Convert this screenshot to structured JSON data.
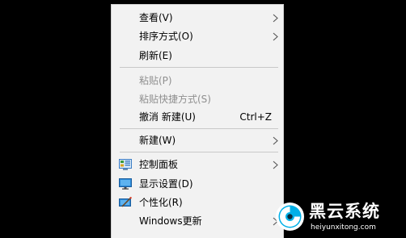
{
  "context_menu": {
    "items": [
      {
        "label": "查看(V)",
        "has_submenu": true
      },
      {
        "label": "排序方式(O)",
        "has_submenu": true
      },
      {
        "label": "刷新(E)"
      },
      {
        "label": "粘贴(P)",
        "disabled": true
      },
      {
        "label": "粘贴快捷方式(S)",
        "disabled": true
      },
      {
        "label": "撤消 新建(U)",
        "shortcut": "Ctrl+Z"
      },
      {
        "label": "新建(W)",
        "has_submenu": true
      },
      {
        "label": "控制面板",
        "has_submenu": true,
        "icon": "control-panel-icon"
      },
      {
        "label": "显示设置(D)",
        "icon": "display-settings-icon"
      },
      {
        "label": "个性化(R)",
        "icon": "personalization-icon"
      },
      {
        "label": "Windows更新",
        "has_submenu": true
      }
    ]
  },
  "watermark": {
    "name": "黑云系统",
    "url": "heiyunxitong.com"
  },
  "colors": {
    "background": "#000000",
    "menu_background": "#f2f2f2",
    "disabled_text": "#8f8f8f",
    "separator": "#c8c8c8",
    "watermark_accent": "#00b0e8"
  }
}
